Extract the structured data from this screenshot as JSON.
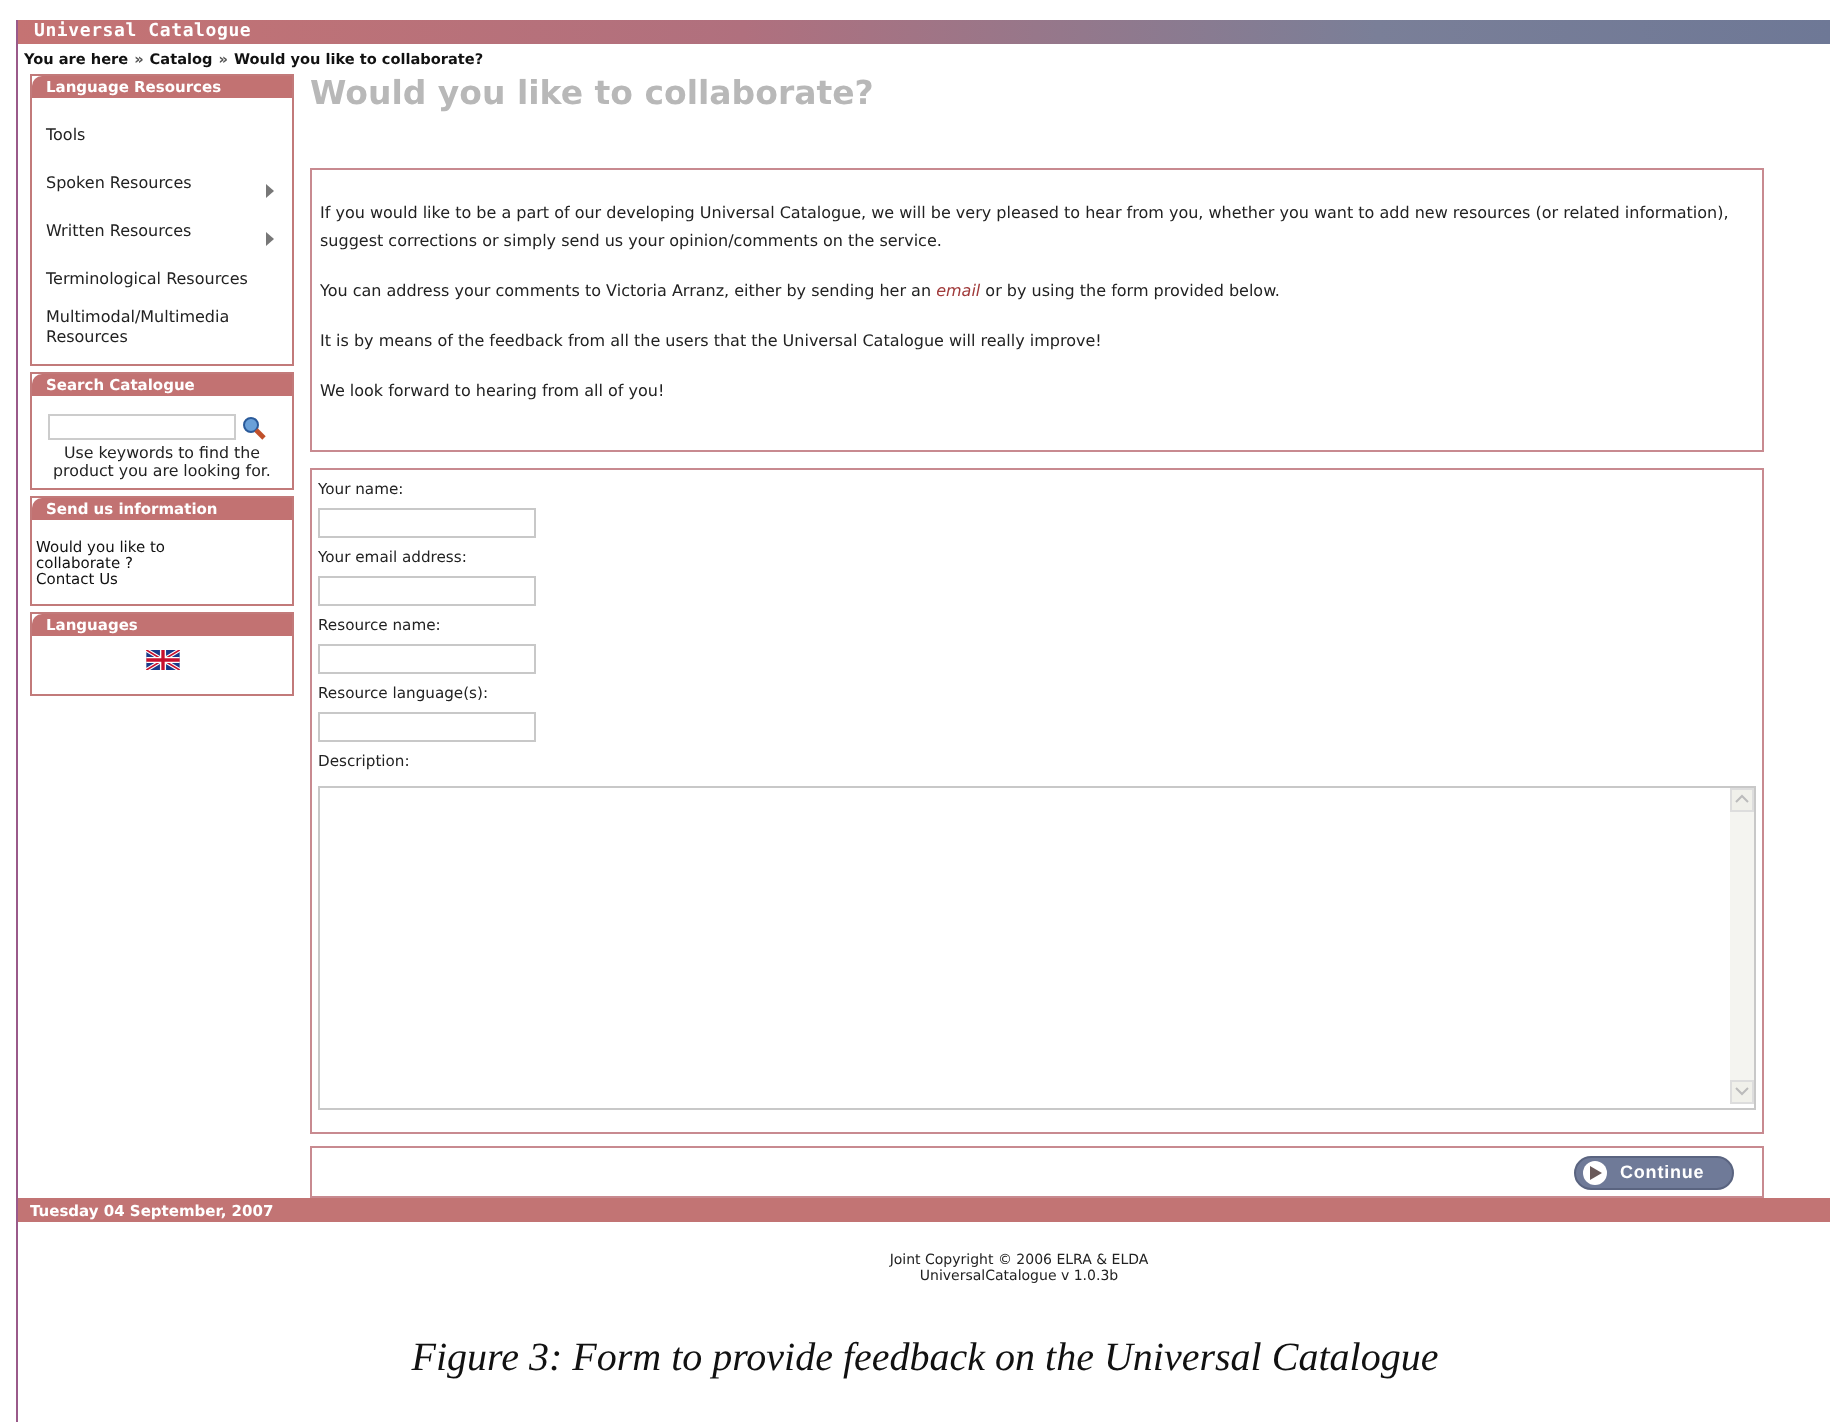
{
  "site_title": "Universal Catalogue",
  "breadcrumb": [
    "You are here",
    "Catalog",
    "Would you like to collaborate?"
  ],
  "breadcrumb_separator": "»",
  "sidebar": {
    "language_resources": {
      "title": "Language Resources",
      "items": [
        {
          "label": "Tools",
          "submenu": false
        },
        {
          "label": "Spoken Resources",
          "submenu": true
        },
        {
          "label": "Written Resources",
          "submenu": true
        },
        {
          "label": "Terminological Resources",
          "submenu": false
        },
        {
          "label": "Multimodal/Multimedia Resources",
          "submenu": false
        }
      ]
    },
    "search": {
      "title": "Search Catalogue",
      "hint": "Use keywords to find the product you are looking for."
    },
    "send_info": {
      "title": "Send us information",
      "links": [
        "Would you like to collaborate ?",
        "Contact Us"
      ]
    },
    "languages": {
      "title": "Languages"
    }
  },
  "page_title": "Would you like to collaborate?",
  "intro": [
    {
      "before": "If you would like to be a part of our developing Universal Catalogue, we will be very pleased to hear from you, whether you want to add new resources (or related information), suggest corrections or simply send us your opinion/comments on the service."
    },
    {
      "before": "You can address your comments to Victoria Arranz, either by sending her an ",
      "link": "email",
      "after": " or by using the form provided below."
    },
    {
      "before": "It is by means of the feedback from all the users that the Universal Catalogue will really improve!"
    },
    {
      "before": "We look forward to hearing from all of you!"
    }
  ],
  "form": {
    "fields": [
      {
        "label": "Your name:",
        "kind": "input"
      },
      {
        "label": "Your email address:",
        "kind": "input"
      },
      {
        "label": "Resource name:",
        "kind": "input"
      },
      {
        "label": "Resource language(s):",
        "kind": "input"
      },
      {
        "label": "Description:",
        "kind": "textarea"
      }
    ],
    "submit": "Continue"
  },
  "date": "Tuesday 04 September, 2007",
  "copyright": [
    "Joint Copyright © 2006 ELRA & ELDA",
    "UniversalCatalogue v 1.0.3b"
  ],
  "caption": "Figure 3: Form to provide feedback on the Universal Catalogue"
}
